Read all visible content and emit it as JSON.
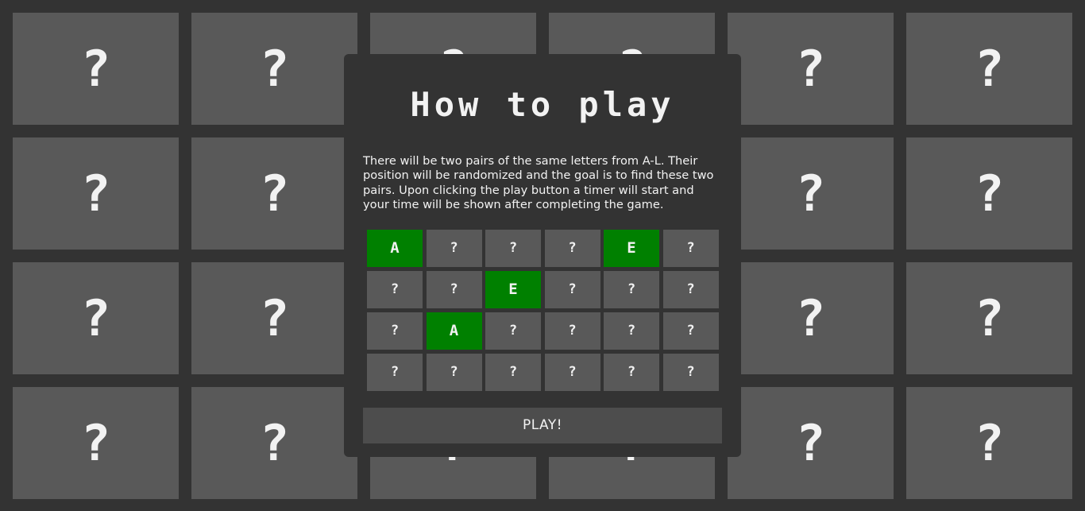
{
  "board": {
    "cards": [
      "?",
      "?",
      "?",
      "?",
      "?",
      "?",
      "?",
      "?",
      "?",
      "?",
      "?",
      "?",
      "?",
      "?",
      "?",
      "?",
      "?",
      "?",
      "?",
      "?",
      "?",
      "?",
      "?",
      "?"
    ]
  },
  "modal": {
    "title": "How to play",
    "description": "There will be two pairs of the same letters from A-L. Their position will be randomized and the goal is to find these two pairs. Upon clicking the play button a timer will start and your time will be shown after completing the game.",
    "demo_grid": [
      {
        "label": "A",
        "revealed": true
      },
      {
        "label": "?",
        "revealed": false
      },
      {
        "label": "?",
        "revealed": false
      },
      {
        "label": "?",
        "revealed": false
      },
      {
        "label": "E",
        "revealed": true
      },
      {
        "label": "?",
        "revealed": false
      },
      {
        "label": "?",
        "revealed": false
      },
      {
        "label": "?",
        "revealed": false
      },
      {
        "label": "E",
        "revealed": true
      },
      {
        "label": "?",
        "revealed": false
      },
      {
        "label": "?",
        "revealed": false
      },
      {
        "label": "?",
        "revealed": false
      },
      {
        "label": "?",
        "revealed": false
      },
      {
        "label": "A",
        "revealed": true
      },
      {
        "label": "?",
        "revealed": false
      },
      {
        "label": "?",
        "revealed": false
      },
      {
        "label": "?",
        "revealed": false
      },
      {
        "label": "?",
        "revealed": false
      },
      {
        "label": "?",
        "revealed": false
      },
      {
        "label": "?",
        "revealed": false
      },
      {
        "label": "?",
        "revealed": false
      },
      {
        "label": "?",
        "revealed": false
      },
      {
        "label": "?",
        "revealed": false
      },
      {
        "label": "?",
        "revealed": false
      }
    ],
    "play_label": "PLAY!"
  },
  "colors": {
    "background": "#333333",
    "card": "#595959",
    "revealed": "#008000",
    "button": "#4d4d4d",
    "text": "#f2f2f2"
  }
}
